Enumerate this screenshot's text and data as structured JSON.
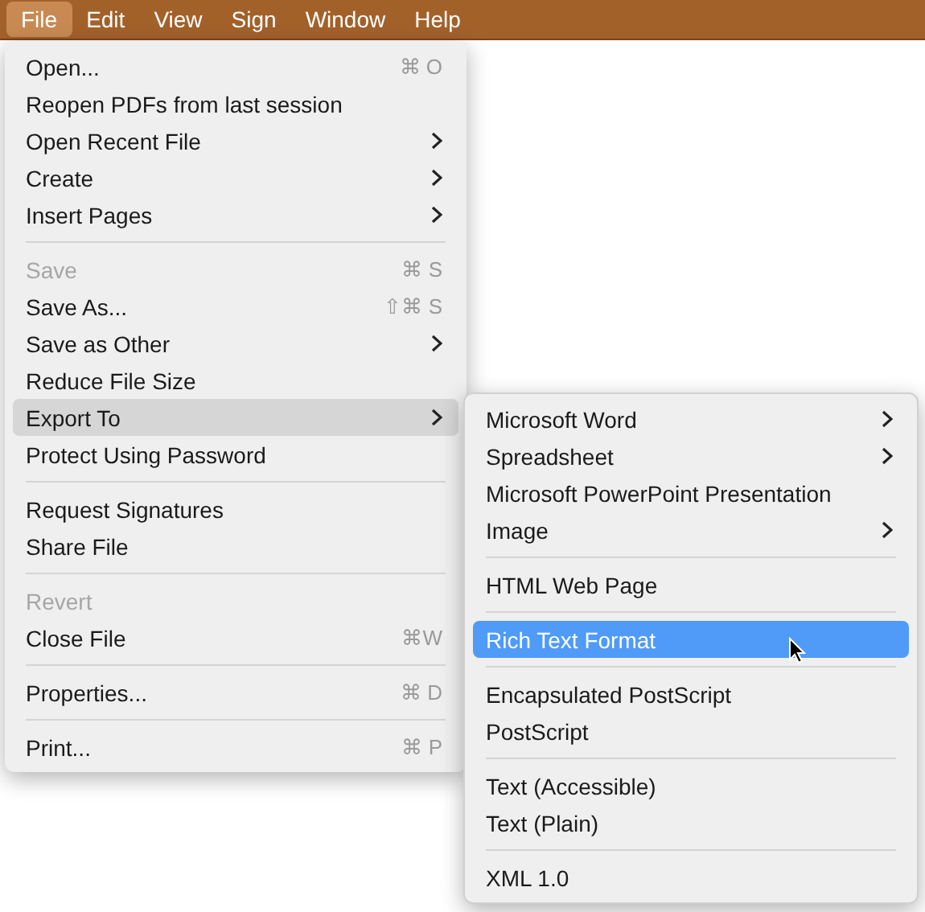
{
  "menubar": [
    {
      "label": "File",
      "selected": true
    },
    {
      "label": "Edit",
      "selected": false
    },
    {
      "label": "View",
      "selected": false
    },
    {
      "label": "Sign",
      "selected": false
    },
    {
      "label": "Window",
      "selected": false
    },
    {
      "label": "Help",
      "selected": false
    }
  ],
  "file_menu": [
    {
      "kind": "item",
      "label": "Open...",
      "shortcut": "⌘ O",
      "submenu": false,
      "disabled": false,
      "selected": false
    },
    {
      "kind": "item",
      "label": "Reopen PDFs from last session",
      "submenu": false,
      "disabled": false,
      "selected": false
    },
    {
      "kind": "item",
      "label": "Open Recent File",
      "submenu": true,
      "disabled": false,
      "selected": false
    },
    {
      "kind": "item",
      "label": "Create",
      "submenu": true,
      "disabled": false,
      "selected": false
    },
    {
      "kind": "item",
      "label": "Insert Pages",
      "submenu": true,
      "disabled": false,
      "selected": false
    },
    {
      "kind": "separator"
    },
    {
      "kind": "item",
      "label": "Save",
      "shortcut": "⌘ S",
      "submenu": false,
      "disabled": true,
      "selected": false
    },
    {
      "kind": "item",
      "label": "Save As...",
      "shortcut": "⇧⌘ S",
      "submenu": false,
      "disabled": false,
      "selected": false
    },
    {
      "kind": "item",
      "label": "Save as Other",
      "submenu": true,
      "disabled": false,
      "selected": false
    },
    {
      "kind": "item",
      "label": "Reduce File Size",
      "submenu": false,
      "disabled": false,
      "selected": false
    },
    {
      "kind": "item",
      "label": "Export To",
      "submenu": true,
      "disabled": false,
      "selected": true
    },
    {
      "kind": "item",
      "label": "Protect Using Password",
      "submenu": false,
      "disabled": false,
      "selected": false
    },
    {
      "kind": "separator"
    },
    {
      "kind": "item",
      "label": "Request Signatures",
      "submenu": false,
      "disabled": false,
      "selected": false
    },
    {
      "kind": "item",
      "label": "Share File",
      "submenu": false,
      "disabled": false,
      "selected": false
    },
    {
      "kind": "separator"
    },
    {
      "kind": "item",
      "label": "Revert",
      "submenu": false,
      "disabled": true,
      "selected": false
    },
    {
      "kind": "item",
      "label": "Close File",
      "shortcut": "⌘W",
      "submenu": false,
      "disabled": false,
      "selected": false
    },
    {
      "kind": "separator"
    },
    {
      "kind": "item",
      "label": "Properties...",
      "shortcut": "⌘ D",
      "submenu": false,
      "disabled": false,
      "selected": false
    },
    {
      "kind": "separator"
    },
    {
      "kind": "item",
      "label": "Print...",
      "shortcut": "⌘ P",
      "submenu": false,
      "disabled": false,
      "selected": false
    }
  ],
  "export_submenu": [
    {
      "kind": "item",
      "label": "Microsoft Word",
      "submenu": true,
      "disabled": false,
      "selected": false
    },
    {
      "kind": "item",
      "label": "Spreadsheet",
      "submenu": true,
      "disabled": false,
      "selected": false
    },
    {
      "kind": "item",
      "label": "Microsoft PowerPoint Presentation",
      "submenu": false,
      "disabled": false,
      "selected": false
    },
    {
      "kind": "item",
      "label": "Image",
      "submenu": true,
      "disabled": false,
      "selected": false
    },
    {
      "kind": "separator"
    },
    {
      "kind": "item",
      "label": "HTML Web Page",
      "submenu": false,
      "disabled": false,
      "selected": false
    },
    {
      "kind": "separator"
    },
    {
      "kind": "item",
      "label": "Rich Text Format",
      "submenu": false,
      "disabled": false,
      "selected": true
    },
    {
      "kind": "separator"
    },
    {
      "kind": "item",
      "label": "Encapsulated PostScript",
      "submenu": false,
      "disabled": false,
      "selected": false
    },
    {
      "kind": "item",
      "label": "PostScript",
      "submenu": false,
      "disabled": false,
      "selected": false
    },
    {
      "kind": "separator"
    },
    {
      "kind": "item",
      "label": "Text (Accessible)",
      "submenu": false,
      "disabled": false,
      "selected": false
    },
    {
      "kind": "item",
      "label": "Text (Plain)",
      "submenu": false,
      "disabled": false,
      "selected": false
    },
    {
      "kind": "separator"
    },
    {
      "kind": "item",
      "label": "XML 1.0",
      "submenu": false,
      "disabled": false,
      "selected": false
    }
  ]
}
